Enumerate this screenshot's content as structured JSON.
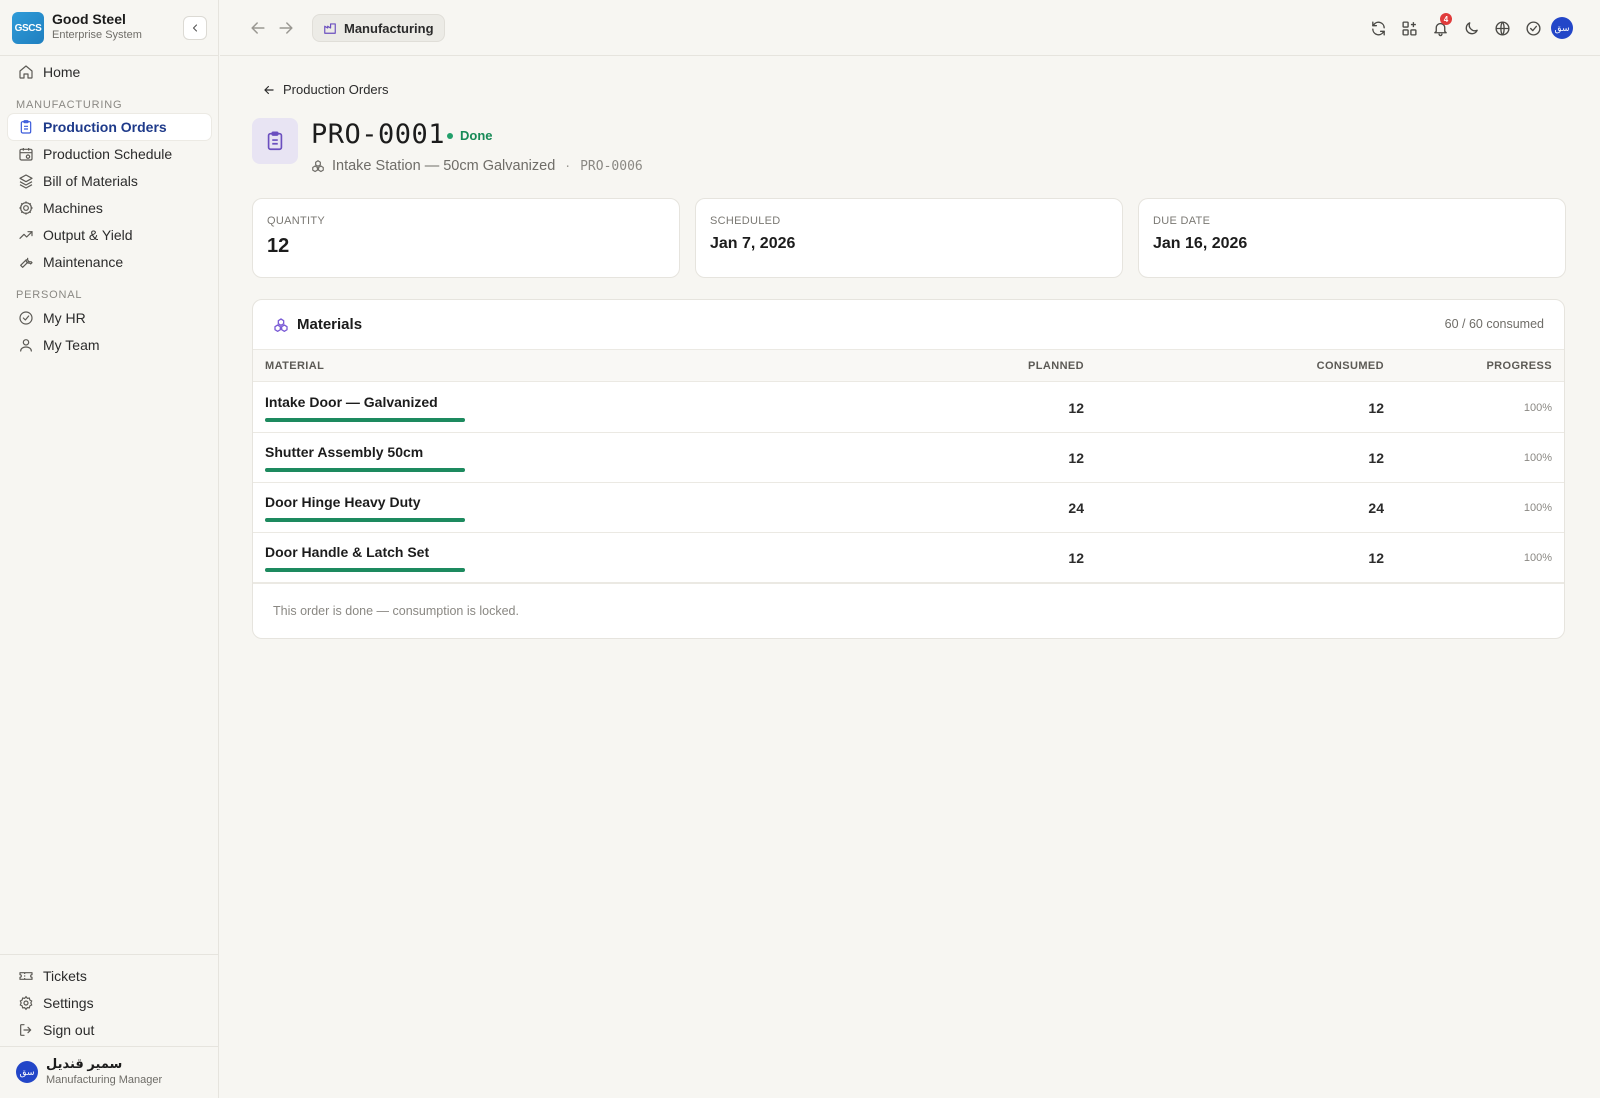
{
  "brand": {
    "logo_text": "GSCS",
    "name": "Good Steel",
    "subtitle": "Enterprise System"
  },
  "sidebar": {
    "home": {
      "label": "Home",
      "icon": "home-icon"
    },
    "sections": {
      "manufacturing": "MANUFACTURING",
      "personal": "PERSONAL"
    },
    "manufacturing_items": [
      {
        "label": "Production Orders",
        "icon": "clipboard-icon",
        "active": true
      },
      {
        "label": "Production Schedule",
        "icon": "calendar-icon"
      },
      {
        "label": "Bill of Materials",
        "icon": "layers-icon"
      },
      {
        "label": "Machines",
        "icon": "cog-icon"
      },
      {
        "label": "Output & Yield",
        "icon": "trending-up-icon"
      },
      {
        "label": "Maintenance",
        "icon": "wrench-icon"
      }
    ],
    "personal_items": [
      {
        "label": "My HR",
        "icon": "check-circle-icon"
      },
      {
        "label": "My Team",
        "icon": "user-icon"
      }
    ],
    "bottom_items": [
      {
        "label": "Tickets",
        "icon": "ticket-icon"
      },
      {
        "label": "Settings",
        "icon": "settings-icon"
      },
      {
        "label": "Sign out",
        "icon": "sign-out-icon"
      }
    ],
    "user": {
      "initials": "سق",
      "name": "سمير قنديل",
      "role": "Manufacturing Manager"
    }
  },
  "topbar": {
    "module_label": "Manufacturing",
    "notification_count": "4",
    "avatar_initials": "سق"
  },
  "page": {
    "back_label": "Production Orders",
    "order_id": "PRO-0001",
    "status": "Done",
    "product": "Intake Station — 50cm Galvanized",
    "ref_code": "PRO-0006"
  },
  "stats": [
    {
      "label": "QUANTITY",
      "value": "12"
    },
    {
      "label": "SCHEDULED",
      "value": "Jan 7, 2026"
    },
    {
      "label": "DUE DATE",
      "value": "Jan 16, 2026"
    }
  ],
  "materials": {
    "title": "Materials",
    "summary": "60 / 60 consumed",
    "columns": {
      "material": "MATERIAL",
      "planned": "PLANNED",
      "consumed": "CONSUMED",
      "progress": "PROGRESS"
    },
    "rows": [
      {
        "name": "Intake Door — Galvanized",
        "planned": "12",
        "consumed": "12",
        "progress": "100%",
        "progress_fraction": 1.0
      },
      {
        "name": "Shutter Assembly 50cm",
        "planned": "12",
        "consumed": "12",
        "progress": "100%",
        "progress_fraction": 1.0
      },
      {
        "name": "Door Hinge Heavy Duty",
        "planned": "24",
        "consumed": "24",
        "progress": "100%",
        "progress_fraction": 1.0
      },
      {
        "name": "Door Handle & Latch Set",
        "planned": "12",
        "consumed": "12",
        "progress": "100%",
        "progress_fraction": 1.0
      }
    ],
    "footer_note": "This order is done — consumption is locked."
  },
  "colors": {
    "accent": "#3b5bdb",
    "success": "#1d8a5f",
    "brand": "#2f9bd8",
    "purple": "#6b4fbf"
  }
}
